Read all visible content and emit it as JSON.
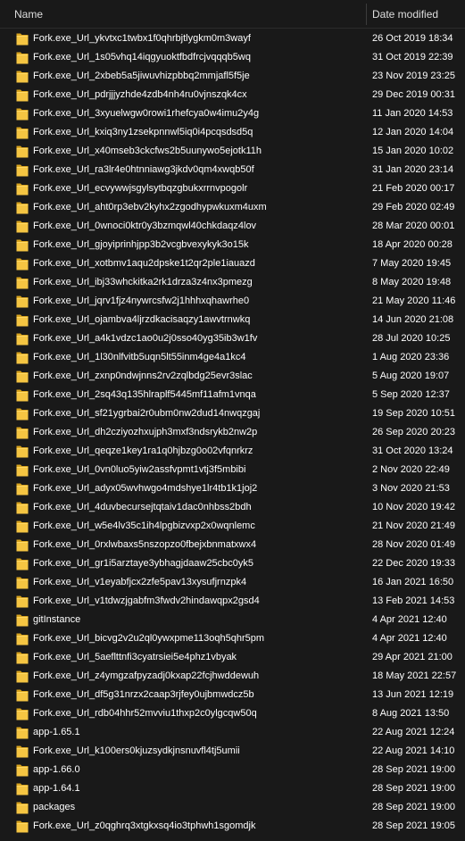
{
  "header": {
    "name_label": "Name",
    "date_label": "Date modified"
  },
  "colors": {
    "background": "#191919",
    "text": "#ffffff",
    "folder": "#f5c542"
  },
  "rows": [
    {
      "name": "Fork.exe_Url_ykvtxc1twbx1f0qhrbjtlygkm0m3wayf",
      "date": "26 Oct 2019 18:34",
      "icon": "folder-icon"
    },
    {
      "name": "Fork.exe_Url_1s05vhq14iqgyuoktfbdfrcjvqqqb5wq",
      "date": "31 Oct 2019 22:39",
      "icon": "folder-icon"
    },
    {
      "name": "Fork.exe_Url_2xbeb5a5jiwuvhizpbbq2mmjafl5f5je",
      "date": "23 Nov 2019 23:25",
      "icon": "folder-icon"
    },
    {
      "name": "Fork.exe_Url_pdrjjjyzhde4zdb4nh4ru0vjnszqk4cx",
      "date": "29 Dec 2019 00:31",
      "icon": "folder-icon"
    },
    {
      "name": "Fork.exe_Url_3xyuelwgw0rowi1rhefcya0w4imu2y4g",
      "date": "11 Jan 2020 14:53",
      "icon": "folder-icon"
    },
    {
      "name": "Fork.exe_Url_kxiq3ny1zsekpnnwl5iq0i4pcqsdsd5q",
      "date": "12 Jan 2020 14:04",
      "icon": "folder-icon"
    },
    {
      "name": "Fork.exe_Url_x40mseb3ckcfws2b5uunywo5ejotk11h",
      "date": "15 Jan 2020 10:02",
      "icon": "folder-icon"
    },
    {
      "name": "Fork.exe_Url_ra3lr4e0htnniawg3jkdv0qm4xwqb50f",
      "date": "31 Jan 2020 23:14",
      "icon": "folder-icon"
    },
    {
      "name": "Fork.exe_Url_ecvywwjsgylsytbqzgbukxrrnvpogolr",
      "date": "21 Feb 2020 00:17",
      "icon": "folder-icon"
    },
    {
      "name": "Fork.exe_Url_aht0rp3ebv2kyhx2zgodhypwkuxm4uxm",
      "date": "29 Feb 2020 02:49",
      "icon": "folder-icon"
    },
    {
      "name": "Fork.exe_Url_0wnoci0ktr0y3bzmqwl40chkdaqz4lov",
      "date": "28 Mar 2020 00:01",
      "icon": "folder-icon"
    },
    {
      "name": "Fork.exe_Url_gjoyiprinhjpp3b2vcgbvexykyk3o15k",
      "date": "18 Apr 2020 00:28",
      "icon": "folder-icon"
    },
    {
      "name": "Fork.exe_Url_xotbmv1aqu2dpske1t2qr2ple1iauazd",
      "date": "7 May 2020 19:45",
      "icon": "folder-icon"
    },
    {
      "name": "Fork.exe_Url_ibj33whckitka2rk1drza3z4nx3pmezg",
      "date": "8 May 2020 19:48",
      "icon": "folder-icon"
    },
    {
      "name": "Fork.exe_Url_jqrv1fjz4nywrcsfw2j1hhhxqhawrhe0",
      "date": "21 May 2020 11:46",
      "icon": "folder-icon"
    },
    {
      "name": "Fork.exe_Url_ojambva4ljrzdkacisaqzy1awvtrnwkq",
      "date": "14 Jun 2020 21:08",
      "icon": "folder-icon"
    },
    {
      "name": "Fork.exe_Url_a4k1vdzc1ao0u2j0sso40yg35ib3w1fv",
      "date": "28 Jul 2020 10:25",
      "icon": "folder-icon"
    },
    {
      "name": "Fork.exe_Url_1l30nlfvitb5uqn5lt55inm4ge4a1kc4",
      "date": "1 Aug 2020 23:36",
      "icon": "folder-icon"
    },
    {
      "name": "Fork.exe_Url_zxnp0ndwjnns2rv2zqlbdg25evr3slac",
      "date": "5 Aug 2020 19:07",
      "icon": "folder-icon"
    },
    {
      "name": "Fork.exe_Url_2sq43q135hlraplf5445mf11afm1vnqa",
      "date": "5 Sep 2020 12:37",
      "icon": "folder-icon"
    },
    {
      "name": "Fork.exe_Url_sf21ygrbai2r0ubm0nw2dud14nwqzgaj",
      "date": "19 Sep 2020 10:51",
      "icon": "folder-icon"
    },
    {
      "name": "Fork.exe_Url_dh2cziyozhxujph3mxf3ndsrykb2nw2p",
      "date": "26 Sep 2020 20:23",
      "icon": "folder-icon"
    },
    {
      "name": "Fork.exe_Url_qeqze1key1ra1q0hjbzg0o02vfqnrkrz",
      "date": "31 Oct 2020 13:24",
      "icon": "folder-icon"
    },
    {
      "name": "Fork.exe_Url_0vn0luo5yiw2assfvpmt1vtj3f5mbibi",
      "date": "2 Nov 2020 22:49",
      "icon": "folder-icon"
    },
    {
      "name": "Fork.exe_Url_adyx05wvhwgo4mdshye1lr4tb1k1joj2",
      "date": "3 Nov 2020 21:53",
      "icon": "folder-icon"
    },
    {
      "name": "Fork.exe_Url_4duvbecursejtqtaiv1dac0nhbss2bdh",
      "date": "10 Nov 2020 19:42",
      "icon": "folder-icon"
    },
    {
      "name": "Fork.exe_Url_w5e4lv35c1ih4lpgbizvxp2x0wqnlemc",
      "date": "21 Nov 2020 21:49",
      "icon": "folder-icon"
    },
    {
      "name": "Fork.exe_Url_0rxlwbaxs5nszopzo0fbejxbnmatxwx4",
      "date": "28 Nov 2020 01:49",
      "icon": "folder-icon"
    },
    {
      "name": "Fork.exe_Url_gr1i5arztaye3ybhagjdaaw25cbc0yk5",
      "date": "22 Dec 2020 19:33",
      "icon": "folder-icon"
    },
    {
      "name": "Fork.exe_Url_v1eyabfjcx2zfe5pav13xysufjrnzpk4",
      "date": "16 Jan 2021 16:50",
      "icon": "folder-icon"
    },
    {
      "name": "Fork.exe_Url_v1tdwzjgabfm3fwdv2hindawqpx2gsd4",
      "date": "13 Feb 2021 14:53",
      "icon": "folder-icon"
    },
    {
      "name": "gitInstance",
      "date": "4 Apr 2021 12:40",
      "icon": "folder-icon"
    },
    {
      "name": "Fork.exe_Url_bicvg2v2u2ql0ywxpme113oqh5qhr5pm",
      "date": "4 Apr 2021 12:40",
      "icon": "folder-icon"
    },
    {
      "name": "Fork.exe_Url_5aeflttnfi3cyatrsiei5e4phz1vbyak",
      "date": "29 Apr 2021 21:00",
      "icon": "folder-icon"
    },
    {
      "name": "Fork.exe_Url_z4ymgzafpyzadj0kxap22fcjhwddewuh",
      "date": "18 May 2021 22:57",
      "icon": "folder-icon"
    },
    {
      "name": "Fork.exe_Url_df5g31nrzx2caap3rjfey0ujbmwdcz5b",
      "date": "13 Jun 2021 12:19",
      "icon": "folder-icon"
    },
    {
      "name": "Fork.exe_Url_rdb04hhr52mvviu1thxp2c0ylgcqw50q",
      "date": "8 Aug 2021 13:50",
      "icon": "folder-icon"
    },
    {
      "name": "app-1.65.1",
      "date": "22 Aug 2021 12:24",
      "icon": "folder-icon"
    },
    {
      "name": "Fork.exe_Url_k100ers0kjuzsydkjnsnuvfl4tj5umii",
      "date": "22 Aug 2021 14:10",
      "icon": "folder-icon"
    },
    {
      "name": "app-1.66.0",
      "date": "28 Sep 2021 19:00",
      "icon": "folder-icon"
    },
    {
      "name": "app-1.64.1",
      "date": "28 Sep 2021 19:00",
      "icon": "folder-icon"
    },
    {
      "name": "packages",
      "date": "28 Sep 2021 19:00",
      "icon": "folder-icon"
    },
    {
      "name": "Fork.exe_Url_z0qghrq3xtgkxsq4io3tphwh1sgomdjk",
      "date": "28 Sep 2021 19:05",
      "icon": "folder-icon"
    }
  ]
}
